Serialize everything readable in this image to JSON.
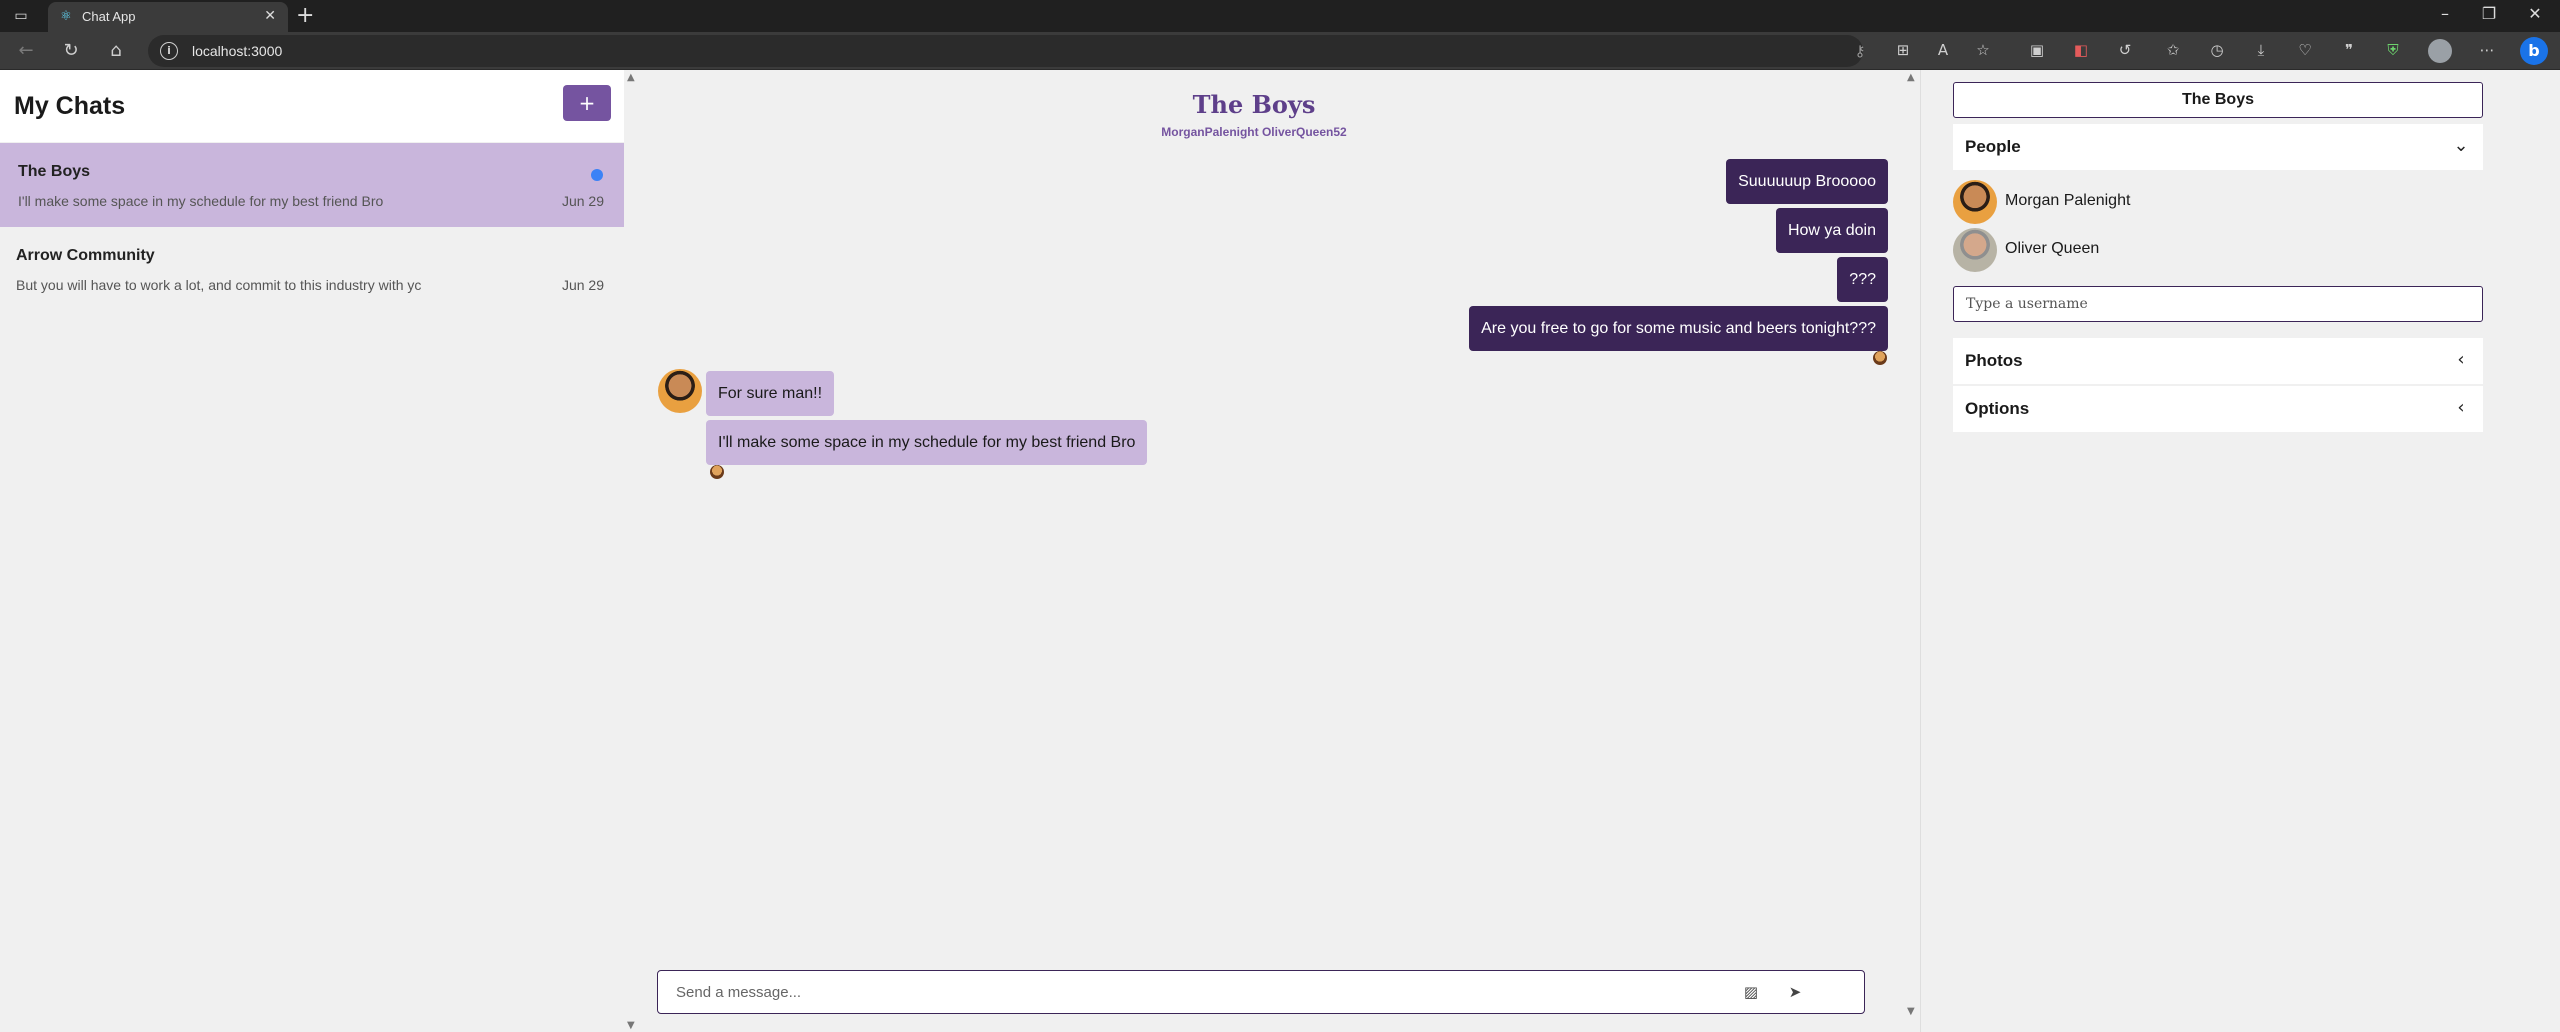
{
  "browser": {
    "tab_title": "Chat App",
    "url": "localhost:3000"
  },
  "chatlist": {
    "title": "My Chats",
    "new_button": "+",
    "chats": [
      {
        "name": "The Boys",
        "preview": "I'll make some space in my schedule for my best friend Bro",
        "date": "Jun 29",
        "unread": true
      },
      {
        "name": "Arrow Community",
        "preview": "But you will have to work a lot, and commit to this industry with yc",
        "date": "Jun 29",
        "unread": false
      }
    ]
  },
  "feed": {
    "title": "The Boys",
    "subtitle": "MorganPalenight OliverQueen52",
    "messages": [
      {
        "text": "Suuuuuup Brooooo",
        "mine": true
      },
      {
        "text": "How ya doin",
        "mine": true
      },
      {
        "text": "???",
        "mine": true
      },
      {
        "text": "Are you free to go for some music and beers tonight???",
        "mine": true
      },
      {
        "text": "For sure man!!",
        "mine": false
      },
      {
        "text": "I'll make some space in my schedule for my best friend Bro",
        "mine": false
      }
    ],
    "compose_placeholder": "Send a message..."
  },
  "settings": {
    "title": "The Boys",
    "people_label": "People",
    "people": [
      {
        "name": "Morgan Palenight"
      },
      {
        "name": "Oliver Queen"
      }
    ],
    "username_placeholder": "Type a username",
    "photos_label": "Photos",
    "options_label": "Options"
  },
  "colors": {
    "accent": "#7554a0",
    "my_bubble": "#3b2557",
    "their_bubble": "#c9b6dc",
    "unread_dot": "#3b82f6"
  }
}
